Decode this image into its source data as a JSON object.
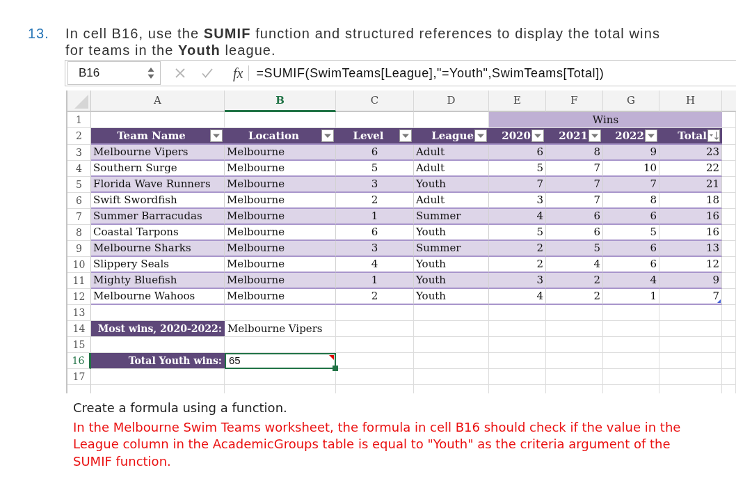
{
  "question": {
    "number": "13.",
    "text": "In cell B16, use the **SUMIF** function and structured references to display the total wins for teams in the **Youth** league."
  },
  "formula_bar": {
    "name_box": "B16",
    "function_label": "fx",
    "formula": "=SUMIF(SwimTeams[League],\"=Youth\",SwimTeams[Total])"
  },
  "sheet": {
    "columns": [
      {
        "label": "A",
        "selected": false
      },
      {
        "label": "B",
        "selected": true
      },
      {
        "label": "C",
        "selected": false
      },
      {
        "label": "D",
        "selected": false
      },
      {
        "label": "E",
        "selected": false
      },
      {
        "label": "F",
        "selected": false
      },
      {
        "label": "G",
        "selected": false
      },
      {
        "label": "H",
        "selected": false
      }
    ],
    "row_numbers": [
      {
        "label": "1",
        "selected": false
      },
      {
        "label": "2",
        "selected": false
      },
      {
        "label": "3",
        "selected": false
      },
      {
        "label": "4",
        "selected": false
      },
      {
        "label": "5",
        "selected": false
      },
      {
        "label": "6",
        "selected": false
      },
      {
        "label": "7",
        "selected": false
      },
      {
        "label": "8",
        "selected": false
      },
      {
        "label": "9",
        "selected": false
      },
      {
        "label": "10",
        "selected": false
      },
      {
        "label": "11",
        "selected": false
      },
      {
        "label": "12",
        "selected": false
      },
      {
        "label": "13",
        "selected": false
      },
      {
        "label": "14",
        "selected": false
      },
      {
        "label": "15",
        "selected": false
      },
      {
        "label": "16",
        "selected": true
      },
      {
        "label": "17",
        "selected": false
      }
    ],
    "group_header": {
      "label": "Wins"
    },
    "table": {
      "headers": [
        {
          "label": "Team Name",
          "sorted": false
        },
        {
          "label": "Location",
          "sorted": false
        },
        {
          "label": "Level",
          "sorted": false
        },
        {
          "label": "League",
          "sorted": false
        },
        {
          "label": "2020",
          "sorted": false
        },
        {
          "label": "2021",
          "sorted": false
        },
        {
          "label": "2022",
          "sorted": false
        },
        {
          "label": "Total",
          "sorted": true
        }
      ],
      "rows": [
        [
          "Melbourne Vipers",
          "Melbourne",
          "6",
          "Adult",
          "6",
          "8",
          "9",
          "23"
        ],
        [
          "Southern Surge",
          "Melbourne",
          "5",
          "Adult",
          "5",
          "7",
          "10",
          "22"
        ],
        [
          "Florida Wave Runners",
          "Melbourne",
          "3",
          "Youth",
          "7",
          "7",
          "7",
          "21"
        ],
        [
          "Swift Swordfish",
          "Melbourne",
          "2",
          "Adult",
          "3",
          "7",
          "8",
          "18"
        ],
        [
          "Summer Barracudas",
          "Melbourne",
          "1",
          "Summer",
          "4",
          "6",
          "6",
          "16"
        ],
        [
          "Coastal Tarpons",
          "Melbourne",
          "6",
          "Youth",
          "5",
          "6",
          "5",
          "16"
        ],
        [
          "Melbourne Sharks",
          "Melbourne",
          "3",
          "Summer",
          "2",
          "5",
          "6",
          "13"
        ],
        [
          "Slippery Seals",
          "Melbourne",
          "4",
          "Youth",
          "2",
          "4",
          "6",
          "12"
        ],
        [
          "Mighty Bluefish",
          "Melbourne",
          "1",
          "Youth",
          "3",
          "2",
          "4",
          "9"
        ],
        [
          "Melbourne Wahoos",
          "Melbourne",
          "2",
          "Youth",
          "4",
          "2",
          "1",
          "7"
        ]
      ]
    },
    "summary": [
      {
        "label": "Most wins, 2020-2022:",
        "value": "Melbourne Vipers",
        "selected": false,
        "commented": false
      },
      {
        "label": "Total Youth wins:",
        "value": "65",
        "selected": true,
        "commented": true
      }
    ]
  },
  "feedback": {
    "instruction": "Create a formula using a function.",
    "message": "In the Melbourne Swim Teams worksheet, the formula in cell B16 should check if the value in the League column in the AcademicGroups table is equal to \"Youth\" as the criteria argument of the SUMIF function."
  }
}
